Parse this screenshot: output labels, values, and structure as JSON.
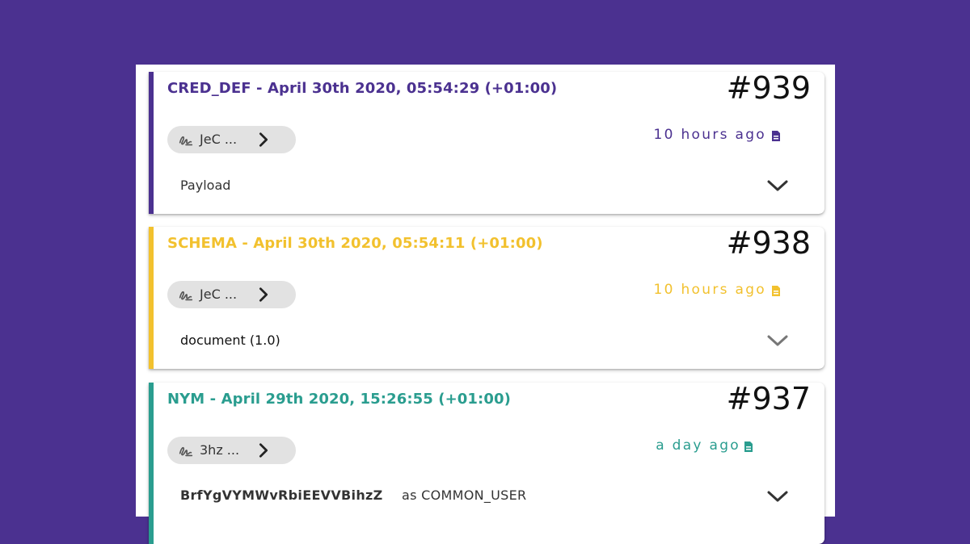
{
  "colors": {
    "background": "#4b3190",
    "cred_def": "#4b3190",
    "schema": "#f2c12e",
    "nym": "#2a9d8f"
  },
  "transactions": [
    {
      "type": "CRED_DEF",
      "title": "CRED_DEF - April 30th 2020, 05:54:29 (+01:00)",
      "number": "#939",
      "did": "JeC ...",
      "ago": "10 hours ago",
      "body": "Payload",
      "icons": [
        "signature-icon",
        "chevron-right-icon",
        "document-icon",
        "chevron-down-icon"
      ]
    },
    {
      "type": "SCHEMA",
      "title": "SCHEMA - April 30th 2020, 05:54:11 (+01:00)",
      "number": "#938",
      "did": "JeC ...",
      "ago": "10 hours ago",
      "body": "document (1.0)",
      "icons": [
        "signature-icon",
        "chevron-right-icon",
        "document-icon",
        "chevron-down-icon"
      ]
    },
    {
      "type": "NYM",
      "title": "NYM - April 29th 2020, 15:26:55 (+01:00)",
      "number": "#937",
      "did": "3hz ...",
      "ago": "a day ago",
      "verkey": "BrfYgVYMWvRbiEEVVBihzZ",
      "role": "as COMMON_USER",
      "icons": [
        "signature-icon",
        "chevron-right-icon",
        "document-icon",
        "chevron-down-icon"
      ]
    }
  ]
}
